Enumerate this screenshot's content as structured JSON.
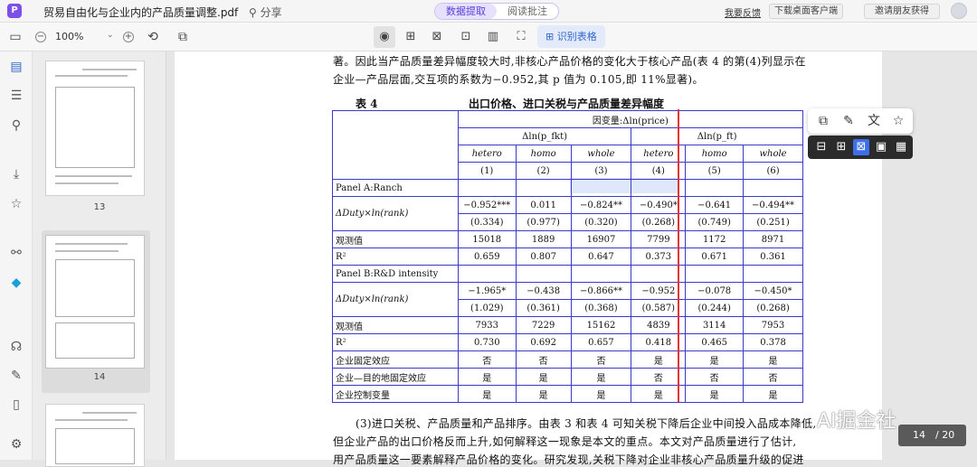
{
  "titlebar": {
    "app_logo": "P",
    "doc_title": "贸易自由化与企业内的产品质量调整.pdf",
    "share": "分享",
    "modes": [
      "数据提取",
      "阅读批注"
    ],
    "feedback": "我要反馈",
    "download": "下载桌面客户端",
    "invite": "邀请朋友获得"
  },
  "toolbar": {
    "zoom": "100%",
    "recognize_table": "识别表格"
  },
  "thumbs": {
    "labels": [
      "13",
      "14"
    ]
  },
  "page": {
    "para_top_1": "著。因此当产品质量差异幅度较大时,非核心产品价格的变化大于核心产品(表 4 的第(4)列显示在",
    "para_top_2": "企业—产品层面,交互项的系数为−0.952,其 p 值为 0.105,即 11%显著)。",
    "table_num": "表 4",
    "table_title": "出口价格、进口关税与产品质量差异幅度",
    "para_bot_1": "(3)进口关税、产品质量和产品排序。由表 3 和表 4 可知关税下降后企业中间投入品成本降低,",
    "para_bot_2": "但企业产品的出口价格反而上升,如何解释这一现象是本文的重点。本文对产品质量进行了估计,",
    "para_bot_3": "用产品质量这一要素解释产品价格的变化。研究发现,关税下降对企业非核心产品质量升级的促进"
  },
  "table": {
    "dep_var": "因变量:Δln(price)",
    "group1": "Δln(p_fkt)",
    "group2": "Δln(p_ft)",
    "col_types": [
      "hetero",
      "homo",
      "whole",
      "hetero",
      "homo",
      "whole"
    ],
    "col_nums": [
      "(1)",
      "(2)",
      "(3)",
      "(4)",
      "(5)",
      "(6)"
    ],
    "panel_a": "Panel A:Ranch",
    "panel_b": "Panel B:R&D intensity",
    "row_var": "ΔDuty×ln(rank)",
    "a_coef": [
      "−0.952***",
      "0.011",
      "−0.824**",
      "−0.490*",
      "−0.641",
      "−0.494**"
    ],
    "a_se": [
      "(0.334)",
      "(0.977)",
      "(0.320)",
      "(0.268)",
      "(0.749)",
      "(0.251)"
    ],
    "a_obs": [
      "15018",
      "1889",
      "16907",
      "7799",
      "1172",
      "8971"
    ],
    "a_r2": [
      "0.659",
      "0.807",
      "0.647",
      "0.373",
      "0.671",
      "0.361"
    ],
    "b_coef": [
      "−1.965*",
      "−0.438",
      "−0.866**",
      "−0.952",
      "−0.078",
      "−0.450*"
    ],
    "b_se": [
      "(1.029)",
      "(0.361)",
      "(0.368)",
      "(0.587)",
      "(0.244)",
      "(0.268)"
    ],
    "b_obs": [
      "7933",
      "7229",
      "15162",
      "4839",
      "3114",
      "7953"
    ],
    "b_r2": [
      "0.730",
      "0.692",
      "0.657",
      "0.418",
      "0.465",
      "0.378"
    ],
    "obs_label": "观测值",
    "r2_label": "R²",
    "fe1_label": "企业固定效应",
    "fe1": [
      "否",
      "否",
      "否",
      "是",
      "是",
      "是"
    ],
    "fe2_label": "企业—目的地固定效应",
    "fe2": [
      "是",
      "是",
      "是",
      "否",
      "否",
      "否"
    ],
    "fe3_label": "企业控制变量",
    "fe3": [
      "是",
      "是",
      "是",
      "是",
      "是",
      "是"
    ]
  },
  "watermark": "AI掘金社",
  "pager": {
    "current": "14",
    "total": "/ 20"
  }
}
